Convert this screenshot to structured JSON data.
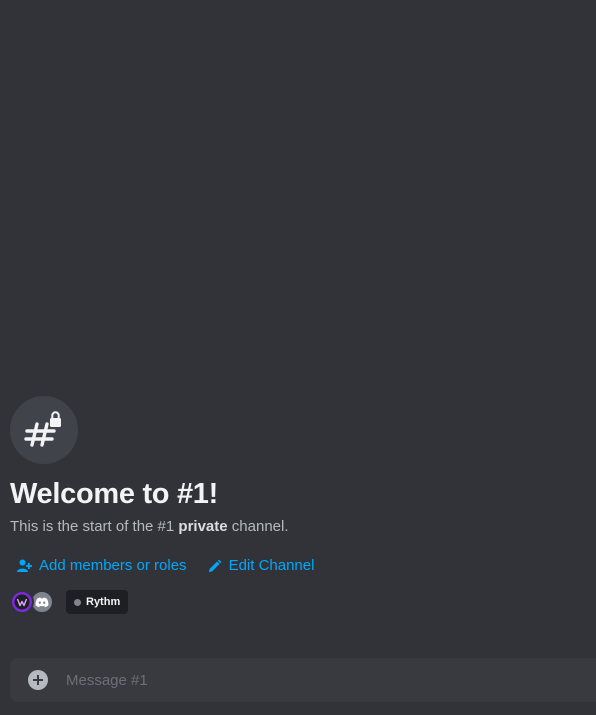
{
  "welcome": {
    "title": "Welcome to #1!",
    "description_prefix": "This is the start of the #1 ",
    "description_bold": "private",
    "description_suffix": " channel."
  },
  "actions": [
    {
      "label": "Add members or roles",
      "icon": "add-member-icon"
    },
    {
      "label": "Edit Channel",
      "icon": "pencil-icon"
    }
  ],
  "members_row": {
    "avatars": [
      "user-avatar",
      "discord-logo-avatar"
    ],
    "bot_tag": {
      "label": "Rythm",
      "status": "offline"
    }
  },
  "composer": {
    "placeholder": "Message #1"
  },
  "colors": {
    "background": "#313338",
    "link": "#00a8fc",
    "composer": "#383a40"
  }
}
